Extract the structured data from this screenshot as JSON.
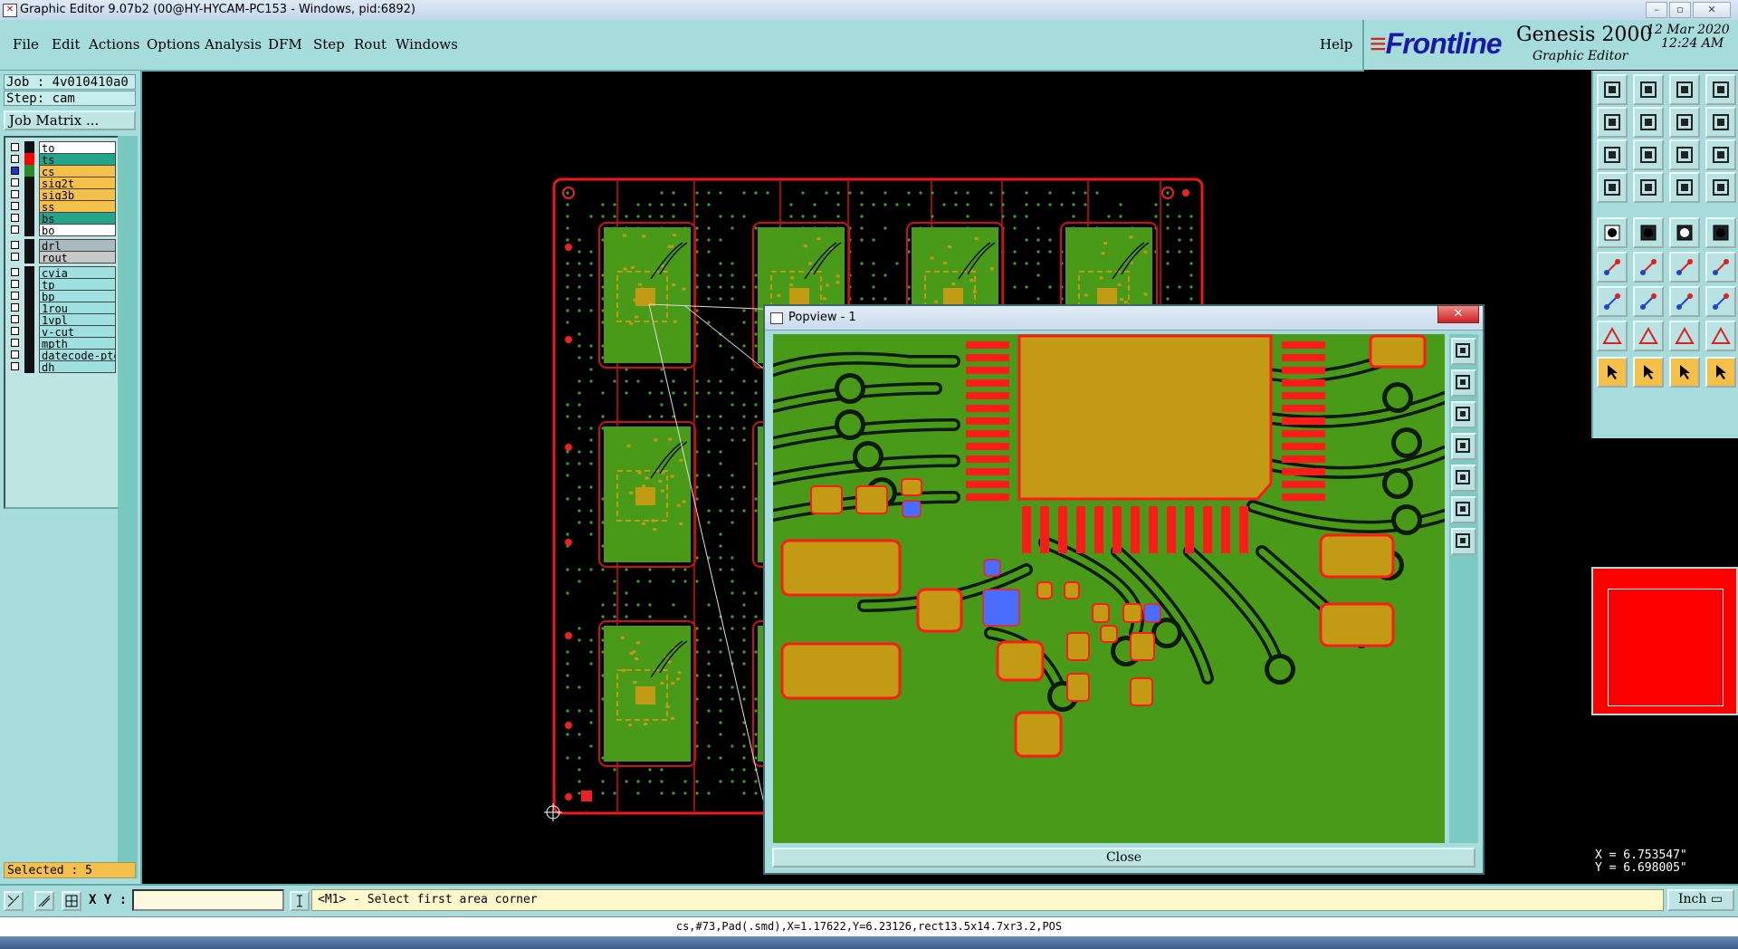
{
  "window": {
    "title": "Graphic Editor 9.07b2 (00@HY-HYCAM-PC153 - Windows, pid:6892)"
  },
  "menu": {
    "items": [
      "File",
      "Edit",
      "Actions",
      "Options",
      "Analysis",
      "DFM",
      "Step",
      "Rout",
      "Windows"
    ],
    "help": "Help"
  },
  "brand": {
    "logo": "Frontline",
    "product": "Genesis 2000",
    "subtitle": "Graphic Editor",
    "date": "12 Mar 2020",
    "time": "12:24 AM"
  },
  "job": {
    "job_line": "Job : 4v010410a0",
    "step_line": "Step: cam",
    "matrix_button": "Job Matrix ..."
  },
  "layers": [
    {
      "name": "to",
      "color": "#ffffff"
    },
    {
      "name": "ts",
      "color": "#23a58c"
    },
    {
      "name": "cs",
      "color": "#f5c04a"
    },
    {
      "name": "sig2t",
      "color": "#f5c04a"
    },
    {
      "name": "sig3b",
      "color": "#f5c04a"
    },
    {
      "name": "ss",
      "color": "#f5c04a"
    },
    {
      "name": "bs",
      "color": "#23a58c"
    },
    {
      "name": "bo",
      "color": "#ffffff"
    },
    {
      "name": "drl",
      "color": "#a9b9c0"
    },
    {
      "name": "rout",
      "color": "#c8c8c8"
    },
    {
      "name": "cvia",
      "color": "#9fe0e0"
    },
    {
      "name": "tp",
      "color": "#9fe0e0"
    },
    {
      "name": "bp",
      "color": "#9fe0e0"
    },
    {
      "name": "1rou",
      "color": "#9fe0e0"
    },
    {
      "name": "1vpl",
      "color": "#9fe0e0"
    },
    {
      "name": "v-cut",
      "color": "#9fe0e0"
    },
    {
      "name": "mpth",
      "color": "#9fe0e0"
    },
    {
      "name": "datecode-pte",
      "color": "#9fe0e0"
    },
    {
      "name": "dh",
      "color": "#9fe0e0"
    }
  ],
  "selected_label": "Selected : 5",
  "bottom": {
    "xy_label": "X Y :",
    "prompt": "<M1> - Select first area corner",
    "unit": "Inch"
  },
  "status": {
    "text": "cs,#73,Pad(.smd),X=1.17622,Y=6.23126,rect13.5x14.7xr3.2,POS"
  },
  "coords": {
    "x": "X = 6.753547\"",
    "y": "Y = 6.698005\""
  },
  "popview": {
    "title": "Popview - 1",
    "close": "Close"
  },
  "colors": {
    "panel": "#a6dcdc",
    "board_green": "#4a9a1a",
    "pad_gold": "#c39a14",
    "outline_red": "#ff1a1a",
    "highlight_blue": "#4a6cff"
  },
  "toolbar_icons": [
    "zoom-home-icon",
    "zoom-in-icon",
    "zoom-out-icon",
    "zoom-fit-icon",
    "pan-left-icon",
    "pan-right-icon",
    "zoom-back-icon",
    "zoom-next-icon",
    "fit-screen-icon",
    "center-icon",
    "ratio-icon",
    "help-icon",
    "measure-icon",
    "snap-icon",
    "profile-icon",
    "grid-icon",
    "select-icon",
    "feature-icon",
    "ruler-icon",
    "point-icon",
    "connect-icon",
    "cross-icon",
    "line-icon",
    "arc-icon",
    "draw-line-icon",
    "draw-slash-icon",
    "rotate-icon",
    "mirror-icon",
    "pad-icon",
    "minus-icon",
    "move-icon",
    "gear-icon",
    "triangle-icon",
    "text-a-icon",
    "text-a2-icon",
    "text-a3-icon",
    "pointer-icon",
    "pointer-select-icon",
    "pointer-edit-icon",
    "pointer-route-icon"
  ]
}
